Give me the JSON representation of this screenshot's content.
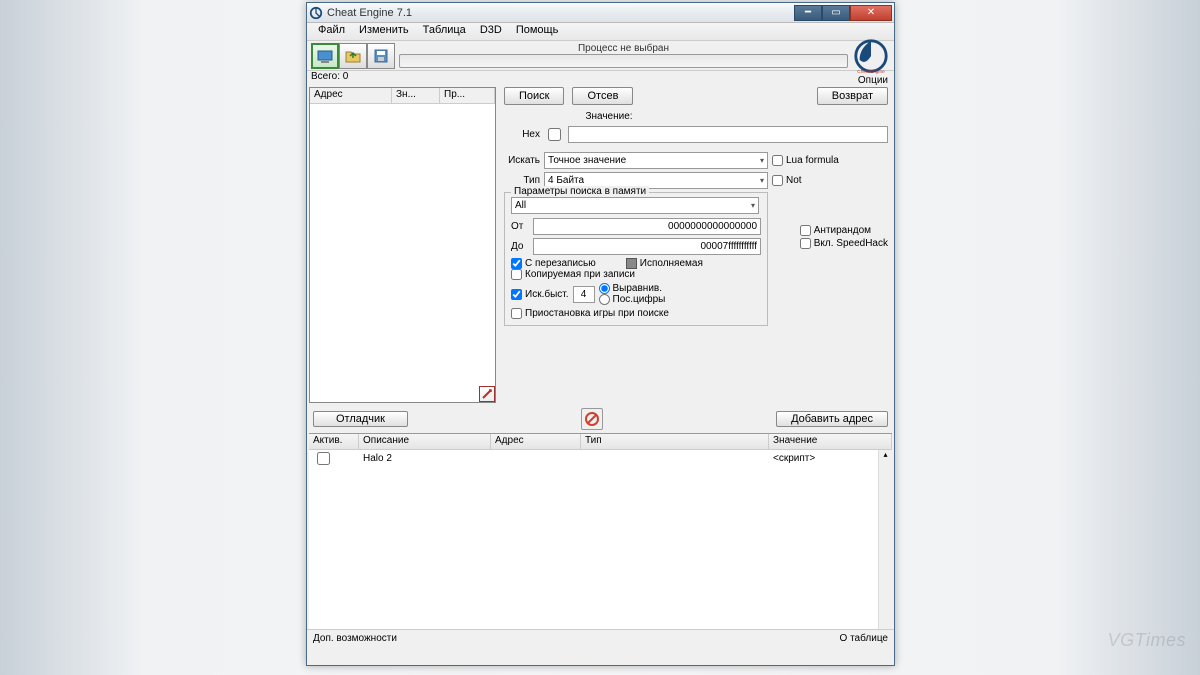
{
  "window": {
    "title": "Cheat Engine 7.1"
  },
  "menu": {
    "file": "Файл",
    "edit": "Изменить",
    "table": "Таблица",
    "d3d": "D3D",
    "help": "Помощь"
  },
  "toolbar": {
    "process_label": "Процесс не выбран",
    "totals": "Всего: 0"
  },
  "left": {
    "col_addr": "Адрес",
    "col_val": "Зн...",
    "col_prev": "Пр..."
  },
  "buttons": {
    "search": "Поиск",
    "filter": "Отсев",
    "return": "Возврат",
    "options": "Опции",
    "debugger": "Отладчик",
    "add_address": "Добавить адрес"
  },
  "labels": {
    "value": "Значение:",
    "hex": "Hex",
    "search_for": "Искать",
    "type": "Тип",
    "lua_formula": "Lua formula",
    "not": "Not",
    "memory_params": "Параметры поиска в памяти",
    "antirandom": "Антирандом",
    "speedhack": "Вкл. SpeedHack",
    "from": "От",
    "to": "До",
    "with_overwrite": "С перезаписью",
    "executable": "Исполняемая",
    "copy_on_write": "Копируемая при записи",
    "fast_scan": "Иск.быст.",
    "alignment": "Выравнив.",
    "last_digits": "Пос.цифры",
    "pause_game": "Приостановка игры при поиске"
  },
  "dropdowns": {
    "search_for": "Точное значение",
    "type": "4 Байта",
    "region": "All"
  },
  "inputs": {
    "value": "",
    "from": "0000000000000000",
    "to": "00007fffffffffff",
    "fast_scan": "4"
  },
  "table": {
    "col_active": "Актив.",
    "col_desc": "Описание",
    "col_addr": "Адрес",
    "col_type": "Тип",
    "col_val": "Значение",
    "rows": [
      {
        "active": false,
        "desc": "Halo 2",
        "addr": "",
        "type": "",
        "val": "<скрипт>"
      }
    ]
  },
  "status": {
    "left": "Доп. возможности",
    "right": "О таблице"
  },
  "watermark": "VGTimes"
}
